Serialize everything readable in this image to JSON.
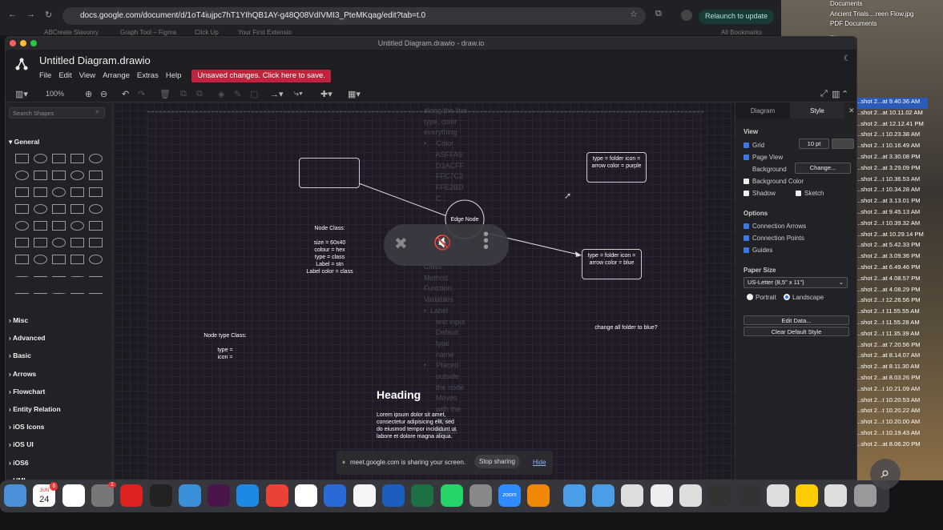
{
  "browser": {
    "url": "docs.google.com/document/d/1oT4iujpc7hT1YIhQB1AY-g48Q08VdIVMI3_PteMKqag/edit?tab=t.0",
    "relaunch": "Relaunch to update",
    "bookmarks_left": "ABCreate Slavonry",
    "bookmark_2": "Graph Tool – Figma",
    "bookmark_3": "Click Up",
    "bookmark_4": "Your First Extensio",
    "all_bookmarks": "All Bookmarks"
  },
  "desktop_files": [
    "Documents",
    "Ancient Trials....reen Flow.jpg",
    "PDF Documents",
    "...",
    "...tations",
    "...sheets",
    "...per",
    "...shots"
  ],
  "screenshots": [
    "...shot 2...at 9.40.36 AM",
    "...shot 2...at 10.11.02 AM",
    "...shot 2...at 12.12.41 PM",
    "...shot 2...t 10.23.38 AM",
    "...shot 2...t 10.16.49 AM",
    "...shot 2...at 3.30.08 PM",
    "...shot 2...at 3.29.09 PM",
    "...shot 2...t 10.36.53 AM",
    "...shot 2...t 10.34.28 AM",
    "...shot 2...at 3.13.01 PM",
    "...shot 2...at 9.45.13 AM",
    "...shot 2...t 10.39.32 AM",
    "...shot 2...at 10.29.14 PM",
    "...shot 2...at 5.42.33 PM",
    "...shot 2...at 3.09.36 PM",
    "...shot 2...at 6.49.46 PM",
    "...shot 2...at 4.08.57 PM",
    "...shot 2...at 4.08.29 PM",
    "...shot 2...t 12.26.56 PM",
    "...shot 2...t 11.55.55 AM",
    "...shot 2...t 11.55.28 AM",
    "...shot 2...t 11.35.39 AM",
    "...shot 2...at 7.20.56 PM",
    "...shot 2...at 8.14.07 AM",
    "...shot 2...at 8.11.30 AM",
    "...shot 2...at 8.03.26 PM",
    "...shot 2...t 10.21.09 AM",
    "...shot 2...t 10.20.53 AM",
    "...shot 2...t 10.20.22 AM",
    "...shot 2...t 10.20.00 AM",
    "...shot 2...t 10.19.43 AM",
    "...shot 2...at 8.06.20 PM"
  ],
  "window": {
    "title": "Untitled Diagram.drawio - draw.io"
  },
  "app": {
    "doc_title": "Untitled Diagram.drawio",
    "menu": [
      "File",
      "Edit",
      "View",
      "Arrange",
      "Extras",
      "Help"
    ],
    "unsaved": "Unsaved changes. Click here to save.",
    "zoom": "100%"
  },
  "sidebar": {
    "search_placeholder": "Search Shapes",
    "general": "General",
    "sections": [
      "Misc",
      "Advanced",
      "Basic",
      "Arrows",
      "Flowchart",
      "Entity Relation",
      "iOS Icons",
      "iOS UI",
      "iOS6",
      "UML"
    ]
  },
  "canvas": {
    "node1": "type = folder\nicon = arrow\ncolor = purple",
    "node2": "type = folder\nicon = arrow\ncolor = blue",
    "edge_node": "Edge Node",
    "node_class": "Node Class:\n\nsize = 60x40\ncolour = hex\ntype = class\nLabel = stn\nLabel color = class",
    "node_type_class": "Node type Class:\n\ntype =\nicon =",
    "change_note": "change all folder to blue?",
    "heading": "Heading",
    "lorem": "Lorem ipsum dolor sit amet,\nconsectetur adipisicing elit, sed\ndo eiusmod tempor incididunt ut\nlabore et dolore magna aliqua.",
    "faint_top": "along the line\ntype, color\neverything\n•     Color\n      ASFFA9\n      D1ACFF\n      FFC7C2\n      FFE2BD\n      C...",
    "faint_mid": "Class\nMethod\nFunction\nVariables\n•  Label\n      text input\n      Default\n      type\n      name\n•     Placed\n      outside\n      the node\n      Moves\n      with the\n      node\n      default"
  },
  "rpanel": {
    "tab_diagram": "Diagram",
    "tab_style": "Style",
    "view": "View",
    "grid": "Grid",
    "grid_size": "10 pt",
    "page_view": "Page View",
    "background": "Background",
    "change": "Change...",
    "bg_color": "Background Color",
    "shadow": "Shadow",
    "sketch": "Sketch",
    "options": "Options",
    "conn_arrows": "Connection Arrows",
    "conn_points": "Connection Points",
    "guides": "Guides",
    "paper_size": "Paper Size",
    "paper_value": "US-Letter (8,5\" x 11\")",
    "portrait": "Portrait",
    "landscape": "Landscape",
    "edit_data": "Edit Data...",
    "clear_style": "Clear Default Style"
  },
  "share": {
    "text": "meet.google.com is sharing your screen.",
    "stop": "Stop sharing",
    "hide": "Hide"
  },
  "dock": {
    "date_month": "JUN",
    "date_day": "24",
    "badge1": "6",
    "badge2": "1",
    "zoom": "zoom"
  }
}
